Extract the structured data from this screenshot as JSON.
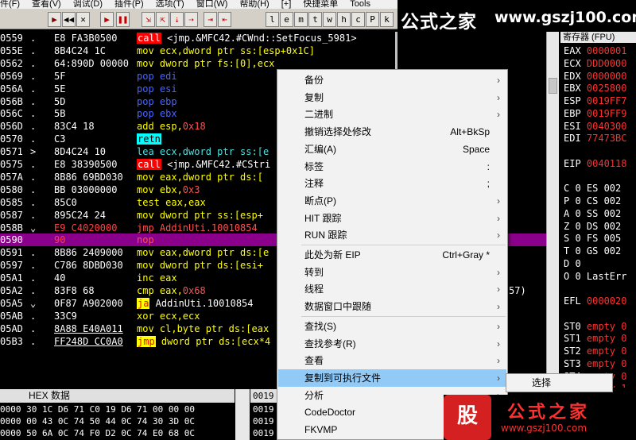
{
  "menubar": [
    "件(F)",
    "查看(V)",
    "调试(D)",
    "插件(P)",
    "选项(T)",
    "窗口(W)",
    "帮助(H)",
    "[+]",
    "快捷菜单",
    "Tools"
  ],
  "toolbar": [
    "▶",
    "◀◀",
    "✕",
    "▶",
    "❚❚",
    "⇲",
    "⇱",
    "⇣",
    "⇢",
    "⇥",
    "⇤",
    "l",
    "e",
    "m",
    "t",
    "w",
    "h",
    "c",
    "P",
    "k"
  ],
  "watermark": {
    "cn": "公式之家",
    "url": "www.gszj100.com"
  },
  "disasm": [
    {
      "addr": "0559",
      "mark": ".",
      "hex": "E8 FA3B0500",
      "asm": [
        [
          "hl",
          "call"
        ],
        [
          "c-white",
          " <jmp.&MFC42.#CWnd::SetFocus_5981>"
        ]
      ]
    },
    {
      "addr": "055E",
      "mark": ".",
      "hex": "8B4C24 1C",
      "asm": [
        [
          "c-mov",
          "mov ecx,dword ptr ss:[esp+0x1C]"
        ]
      ]
    },
    {
      "addr": "0562",
      "mark": ".",
      "hex": "64:890D 00000",
      "asm": [
        [
          "c-mov",
          "mov dword ptr fs:[0],ecx"
        ]
      ]
    },
    {
      "addr": "0569",
      "mark": ".",
      "hex": "5F",
      "asm": [
        [
          "c-pop",
          "pop edi"
        ]
      ]
    },
    {
      "addr": "056A",
      "mark": ".",
      "hex": "5E",
      "asm": [
        [
          "c-pop",
          "pop esi"
        ]
      ]
    },
    {
      "addr": "056B",
      "mark": ".",
      "hex": "5D",
      "asm": [
        [
          "c-pop",
          "pop ebp"
        ]
      ]
    },
    {
      "addr": "056C",
      "mark": ".",
      "hex": "5B",
      "asm": [
        [
          "c-pop",
          "pop ebx"
        ]
      ]
    },
    {
      "addr": "056D",
      "mark": ".",
      "hex": "83C4 18",
      "asm": [
        [
          "c-mov",
          "add esp,"
        ],
        [
          "c-red",
          "0x18"
        ]
      ]
    },
    {
      "addr": "0570",
      "mark": ".",
      "hex": "C3",
      "asm": [
        [
          "hl-c",
          "retn"
        ]
      ]
    },
    {
      "addr": "0571",
      "mark": ">",
      "hex": "8D4C24 10",
      "asm": [
        [
          "c-teal",
          "lea ecx,dword ptr ss:[e"
        ]
      ]
    },
    {
      "addr": "0575",
      "mark": ".",
      "hex": "E8 38390500",
      "asm": [
        [
          "hl",
          "call"
        ],
        [
          "c-white",
          " <jmp.&MFC42.#CStri"
        ]
      ]
    },
    {
      "addr": "057A",
      "mark": ".",
      "hex": "8B86 69BD030",
      "asm": [
        [
          "c-mov",
          "mov eax,dword ptr ds:["
        ]
      ]
    },
    {
      "addr": "0580",
      "mark": ".",
      "hex": "BB 03000000",
      "asm": [
        [
          "c-mov",
          "mov ebx,"
        ],
        [
          "c-red",
          "0x3"
        ]
      ]
    },
    {
      "addr": "0585",
      "mark": ".",
      "hex": "85C0",
      "asm": [
        [
          "c-mov",
          "test eax,eax"
        ]
      ]
    },
    {
      "addr": "0587",
      "mark": ".",
      "hex": "895C24 24",
      "asm": [
        [
          "c-mov",
          "mov dword ptr ss:[esp+"
        ]
      ]
    },
    {
      "addr": "058B",
      "mark": "⌄",
      "hex": "E9 C4020000",
      "hexred": true,
      "asm": [
        [
          "c-red",
          "jmp AddinUti.10010854"
        ]
      ]
    },
    {
      "addr": "0590",
      "mark": "",
      "hex": "90",
      "selected": true,
      "asm": [
        [
          "c-red",
          "nop"
        ]
      ]
    },
    {
      "addr": "0591",
      "mark": ".",
      "hex": "8B86 2409000",
      "asm": [
        [
          "c-mov",
          "mov eax,dword ptr ds:[e"
        ]
      ]
    },
    {
      "addr": "0597",
      "mark": ".",
      "hex": "C786 8DBD030",
      "asm": [
        [
          "c-mov",
          "mov dword ptr ds:[esi+"
        ]
      ]
    },
    {
      "addr": "05A1",
      "mark": ".",
      "hex": "40",
      "asm": [
        [
          "c-mov",
          "inc eax"
        ]
      ]
    },
    {
      "addr": "05A2",
      "mark": ".",
      "hex": "83F8 68",
      "asm": [
        [
          "c-mov",
          "cmp eax,"
        ],
        [
          "c-red",
          "0x68"
        ]
      ]
    },
    {
      "addr": "05A5",
      "mark": "⌄",
      "hex": "0F87 A902000",
      "asm": [
        [
          "hl-y",
          "ja"
        ],
        [
          "c-white",
          " AddinUti.10010854"
        ]
      ]
    },
    {
      "addr": "05AB",
      "mark": ".",
      "hex": "33C9",
      "asm": [
        [
          "c-mov",
          "xor ecx,ecx"
        ]
      ]
    },
    {
      "addr": "05AD",
      "mark": ".",
      "hex": "8A88 E40A011",
      "hexunder": true,
      "asm": [
        [
          "c-mov",
          "mov cl,byte ptr ds:[eax"
        ]
      ]
    },
    {
      "addr": "05B3",
      "mark": ".",
      "hex": "FF248D CC0A0",
      "hexunder": true,
      "asm": [
        [
          "hl-y",
          "jmp"
        ],
        [
          "c-mov",
          " dword ptr ds:[ecx*4"
        ]
      ]
    }
  ],
  "disasm_tail": "57)",
  "registers": {
    "title": "寄存器 (FPU)",
    "rows": [
      [
        "EAX",
        "0000001"
      ],
      [
        "ECX",
        "DDD0000"
      ],
      [
        "EDX",
        "0000000"
      ],
      [
        "EBX",
        "0025800"
      ],
      [
        "ESP",
        "0019FF7"
      ],
      [
        "EBP",
        "0019FF9"
      ],
      [
        "ESI",
        "0040300"
      ],
      [
        "EDI",
        "77473BC"
      ],
      [
        "",
        ""
      ],
      [
        "EIP",
        "0040118"
      ],
      [
        "",
        ""
      ],
      [
        "C 0",
        "ES 002"
      ],
      [
        "P 0",
        "CS 002"
      ],
      [
        "A 0",
        "SS 002"
      ],
      [
        "Z 0",
        "DS 002"
      ],
      [
        "S 0",
        "FS 005"
      ],
      [
        "T 0",
        "GS 002"
      ],
      [
        "D 0",
        ""
      ],
      [
        "O 0",
        "LastErr"
      ],
      [
        "",
        ""
      ],
      [
        "EFL",
        "0000020"
      ],
      [
        "",
        ""
      ],
      [
        "ST0",
        "empty 0"
      ],
      [
        "ST1",
        "empty 0"
      ],
      [
        "ST2",
        "empty 0"
      ],
      [
        "ST3",
        "empty 0"
      ],
      [
        "ST4",
        "empty 0"
      ],
      [
        "ST5",
        "empty 1"
      ]
    ]
  },
  "hexdump": {
    "header": "HEX 数据",
    "rows": [
      "0000 30 1C D6 71 C0 19 D6 71 00 00 00",
      "0000 00 43 0C 74 50 44 0C 74 30 3D 0C",
      "0000 50 6A 0C 74 F0 D2 0C 74 E0 68 0C"
    ]
  },
  "stack": {
    "header": "0019",
    "rows": [
      "0019",
      "0019",
      "0019"
    ]
  },
  "context_menu": {
    "items": [
      {
        "label": "备份",
        "shortcut": "",
        "arrow": true
      },
      {
        "label": "复制",
        "shortcut": "",
        "arrow": true
      },
      {
        "label": "二进制",
        "shortcut": "",
        "arrow": true
      },
      {
        "label": "撤销选择处修改",
        "shortcut": "Alt+BkSp",
        "arrow": false
      },
      {
        "label": "汇编(A)",
        "shortcut": "Space",
        "arrow": false
      },
      {
        "label": "标签",
        "shortcut": ":",
        "arrow": false
      },
      {
        "label": "注释",
        "shortcut": ";",
        "arrow": false
      },
      {
        "label": "断点(P)",
        "shortcut": "",
        "arrow": true
      },
      {
        "label": "HIT 跟踪",
        "shortcut": "",
        "arrow": true
      },
      {
        "label": "RUN 跟踪",
        "shortcut": "",
        "arrow": true
      },
      {
        "sep": true
      },
      {
        "label": "此处为新 EIP",
        "shortcut": "Ctrl+Gray *",
        "arrow": false
      },
      {
        "label": "转到",
        "shortcut": "",
        "arrow": true
      },
      {
        "label": "线程",
        "shortcut": "",
        "arrow": true
      },
      {
        "label": "数据窗口中跟随",
        "shortcut": "",
        "arrow": true
      },
      {
        "sep": true
      },
      {
        "label": "查找(S)",
        "shortcut": "",
        "arrow": true
      },
      {
        "label": "查找参考(R)",
        "shortcut": "",
        "arrow": true
      },
      {
        "label": "查看",
        "shortcut": "",
        "arrow": true
      },
      {
        "label": "复制到可执行文件",
        "shortcut": "",
        "arrow": true,
        "hover": true
      },
      {
        "label": "分析",
        "shortcut": "",
        "arrow": true
      },
      {
        "label": "CodeDoctor",
        "shortcut": "",
        "arrow": true
      },
      {
        "label": "FKVMP",
        "shortcut": "",
        "arrow": true
      }
    ]
  },
  "submenu": {
    "label": "选择"
  },
  "logo_bottom": {
    "badge": "股",
    "cn": "公式之家",
    "url": "www.gszj100.com"
  },
  "colors": {
    "selection": "#8b008b",
    "menu_hover": "#91c9f7",
    "call_bg": "#ff0000",
    "jump_bg": "#ffff00",
    "retn_bg": "#00ffff"
  }
}
